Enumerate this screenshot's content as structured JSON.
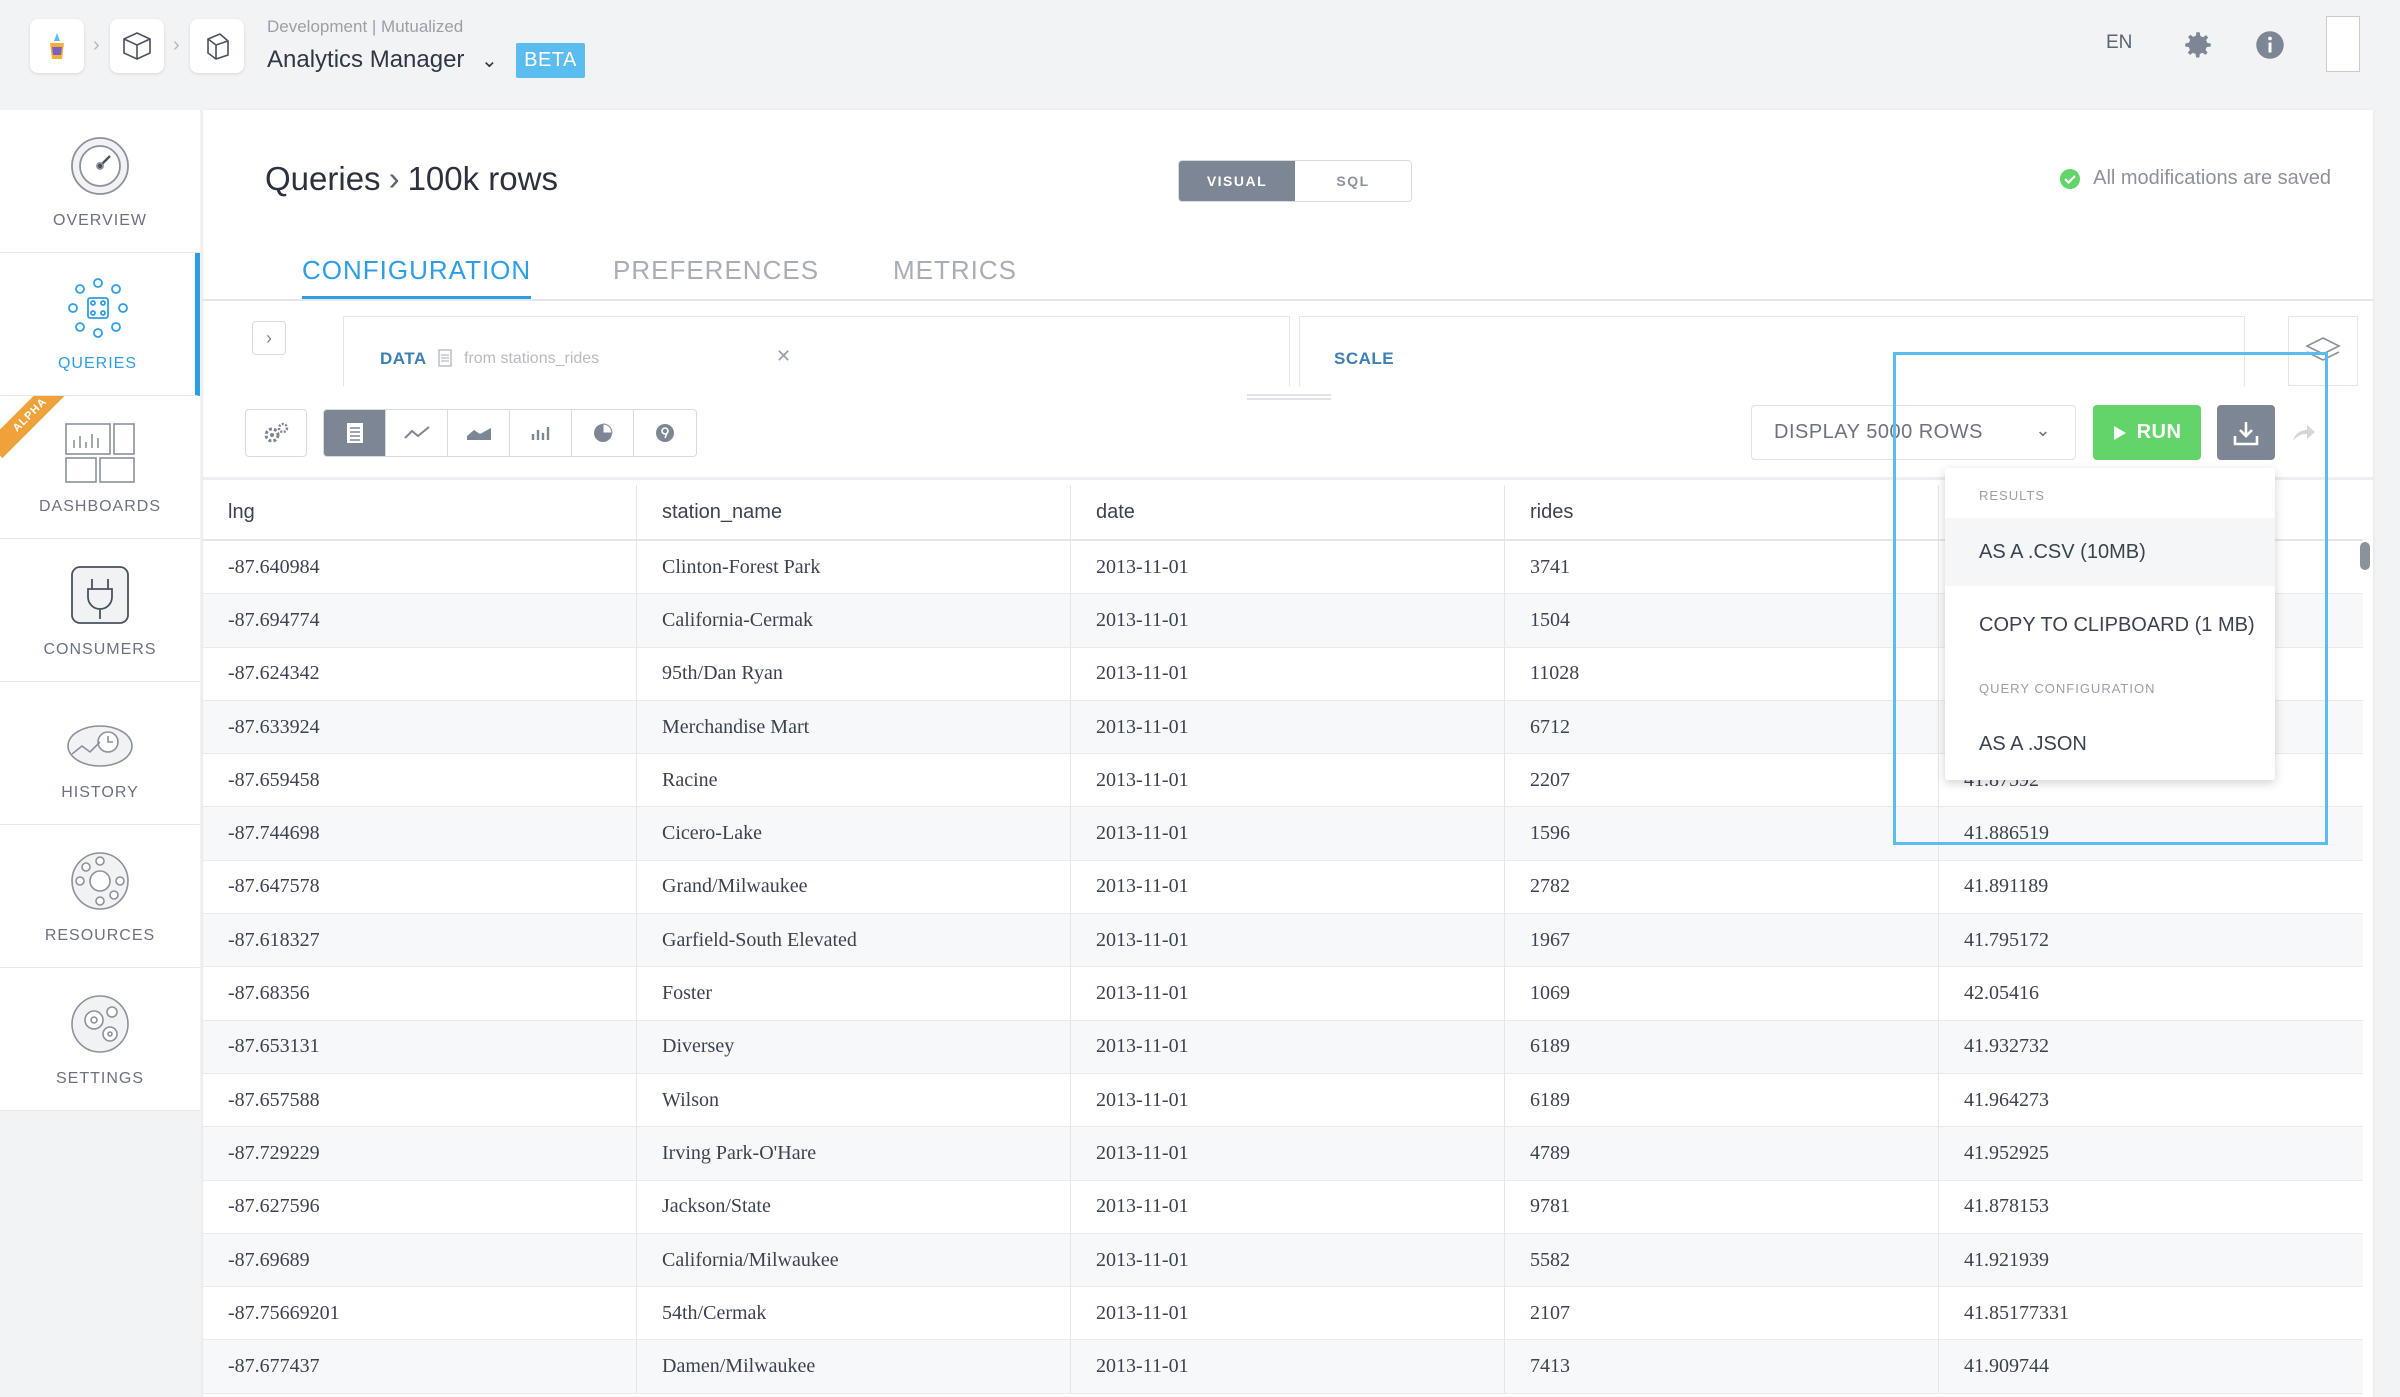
{
  "header": {
    "environment": "Development | Mutualized",
    "app_title": "Analytics Manager",
    "badge": "BETA",
    "language": "EN"
  },
  "sidebar": {
    "items": [
      {
        "label": "OVERVIEW",
        "icon": "gauge-icon"
      },
      {
        "label": "QUERIES",
        "icon": "queries-icon"
      },
      {
        "label": "DASHBOARDS",
        "icon": "dashboard-icon",
        "ribbon": "ALPHA"
      },
      {
        "label": "CONSUMERS",
        "icon": "plug-icon"
      },
      {
        "label": "HISTORY",
        "icon": "history-icon"
      },
      {
        "label": "RESOURCES",
        "icon": "resources-icon"
      },
      {
        "label": "SETTINGS",
        "icon": "gears-icon"
      }
    ]
  },
  "page": {
    "breadcrumb_root": "Queries",
    "breadcrumb_current": "100k rows",
    "mode_visual": "VISUAL",
    "mode_sql": "SQL",
    "saved_status": "All modifications are saved"
  },
  "tabs": [
    "CONFIGURATION",
    "PREFERENCES",
    "METRICS"
  ],
  "config": {
    "data_label": "DATA",
    "data_source": "from stations_rides",
    "scale_label": "SCALE"
  },
  "toolbar": {
    "display_rows": "DISPLAY 5000 ROWS",
    "run_label": "RUN"
  },
  "table": {
    "columns": [
      "lng",
      "station_name",
      "date",
      "rides",
      ""
    ],
    "rows": [
      [
        "-87.640984",
        "Clinton-Forest Park",
        "2013-11-01",
        "3741",
        ""
      ],
      [
        "-87.694774",
        "California-Cermak",
        "2013-11-01",
        "1504",
        ""
      ],
      [
        "-87.624342",
        "95th/Dan Ryan",
        "2013-11-01",
        "11028",
        ""
      ],
      [
        "-87.633924",
        "Merchandise Mart",
        "2013-11-01",
        "6712",
        ""
      ],
      [
        "-87.659458",
        "Racine",
        "2013-11-01",
        "2207",
        "41.87592"
      ],
      [
        "-87.744698",
        "Cicero-Lake",
        "2013-11-01",
        "1596",
        "41.886519"
      ],
      [
        "-87.647578",
        "Grand/Milwaukee",
        "2013-11-01",
        "2782",
        "41.891189"
      ],
      [
        "-87.618327",
        "Garfield-South Elevated",
        "2013-11-01",
        "1967",
        "41.795172"
      ],
      [
        "-87.68356",
        "Foster",
        "2013-11-01",
        "1069",
        "42.05416"
      ],
      [
        "-87.653131",
        "Diversey",
        "2013-11-01",
        "6189",
        "41.932732"
      ],
      [
        "-87.657588",
        "Wilson",
        "2013-11-01",
        "6189",
        "41.964273"
      ],
      [
        "-87.729229",
        "Irving Park-O'Hare",
        "2013-11-01",
        "4789",
        "41.952925"
      ],
      [
        "-87.627596",
        "Jackson/State",
        "2013-11-01",
        "9781",
        "41.878153"
      ],
      [
        "-87.69689",
        "California/Milwaukee",
        "2013-11-01",
        "5582",
        "41.921939"
      ],
      [
        "-87.75669201",
        "54th/Cermak",
        "2013-11-01",
        "2107",
        "41.85177331"
      ],
      [
        "-87.677437",
        "Damen/Milwaukee",
        "2013-11-01",
        "7413",
        "41.909744"
      ]
    ]
  },
  "dropdown": {
    "section_results": "RESULTS",
    "csv": "AS A .CSV (10MB)",
    "clipboard": "COPY TO CLIPBOARD (1 MB)",
    "section_config": "QUERY CONFIGURATION",
    "json": "AS A .JSON"
  },
  "colors": {
    "accent": "#2d9ee6",
    "run": "#62d46a",
    "beta": "#5bbcef",
    "saved_check": "#62d46a"
  }
}
